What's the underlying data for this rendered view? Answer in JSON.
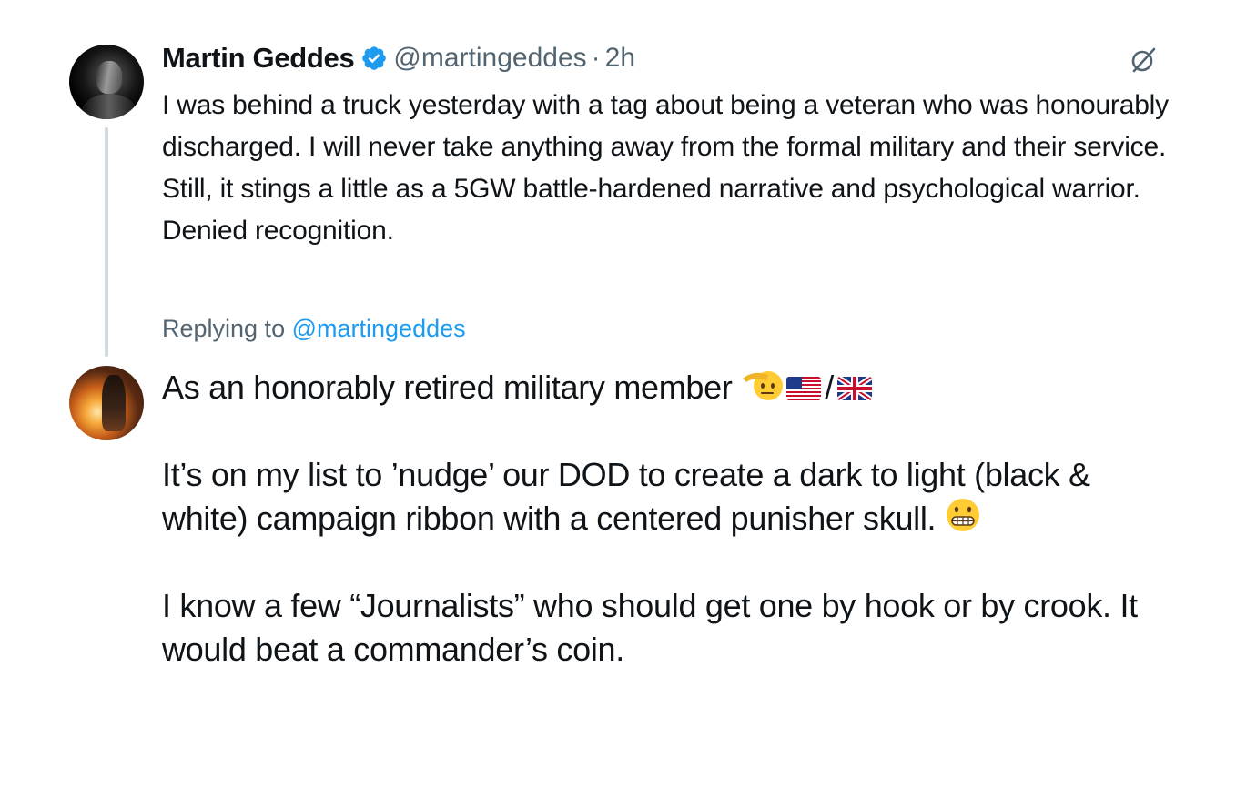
{
  "tweet": {
    "author_name": "Martin Geddes",
    "handle": "@martingeddes",
    "separator": "·",
    "time": "2h",
    "text": "I was behind a truck yesterday with a tag about being a veteran who was honourably discharged. I will never take anything away from the formal military and their service. Still, it stings a little as a 5GW battle-hardened narrative and psychological warrior. Denied recognition.",
    "verified_color": "#1d9bf0"
  },
  "reply": {
    "replying_prefix": "Replying to",
    "replying_to": "@martingeddes",
    "line1": "As an honorably retired military member",
    "slash": "/",
    "paragraph2": "It’s on my list to ’nudge’ our DOD to create a dark to light (black & white) campaign ribbon with a centered punisher skull.",
    "paragraph3": "I know a few “Journalists” who should get one by hook or by crook. It would beat a commander’s coin."
  },
  "icons": {
    "avatar_1": "avatar-martin-geddes",
    "avatar_2": "avatar-reply-author",
    "verified": "verified-badge-icon",
    "grok": "grok-icon",
    "emojis": [
      "saluting-face-emoji",
      "us-flag-emoji",
      "uk-flag-emoji",
      "grimacing-face-emoji"
    ]
  },
  "colors": {
    "text": "#0f1419",
    "secondary": "#536471",
    "link": "#1d9bf0",
    "thread_line": "#cfd9de"
  }
}
